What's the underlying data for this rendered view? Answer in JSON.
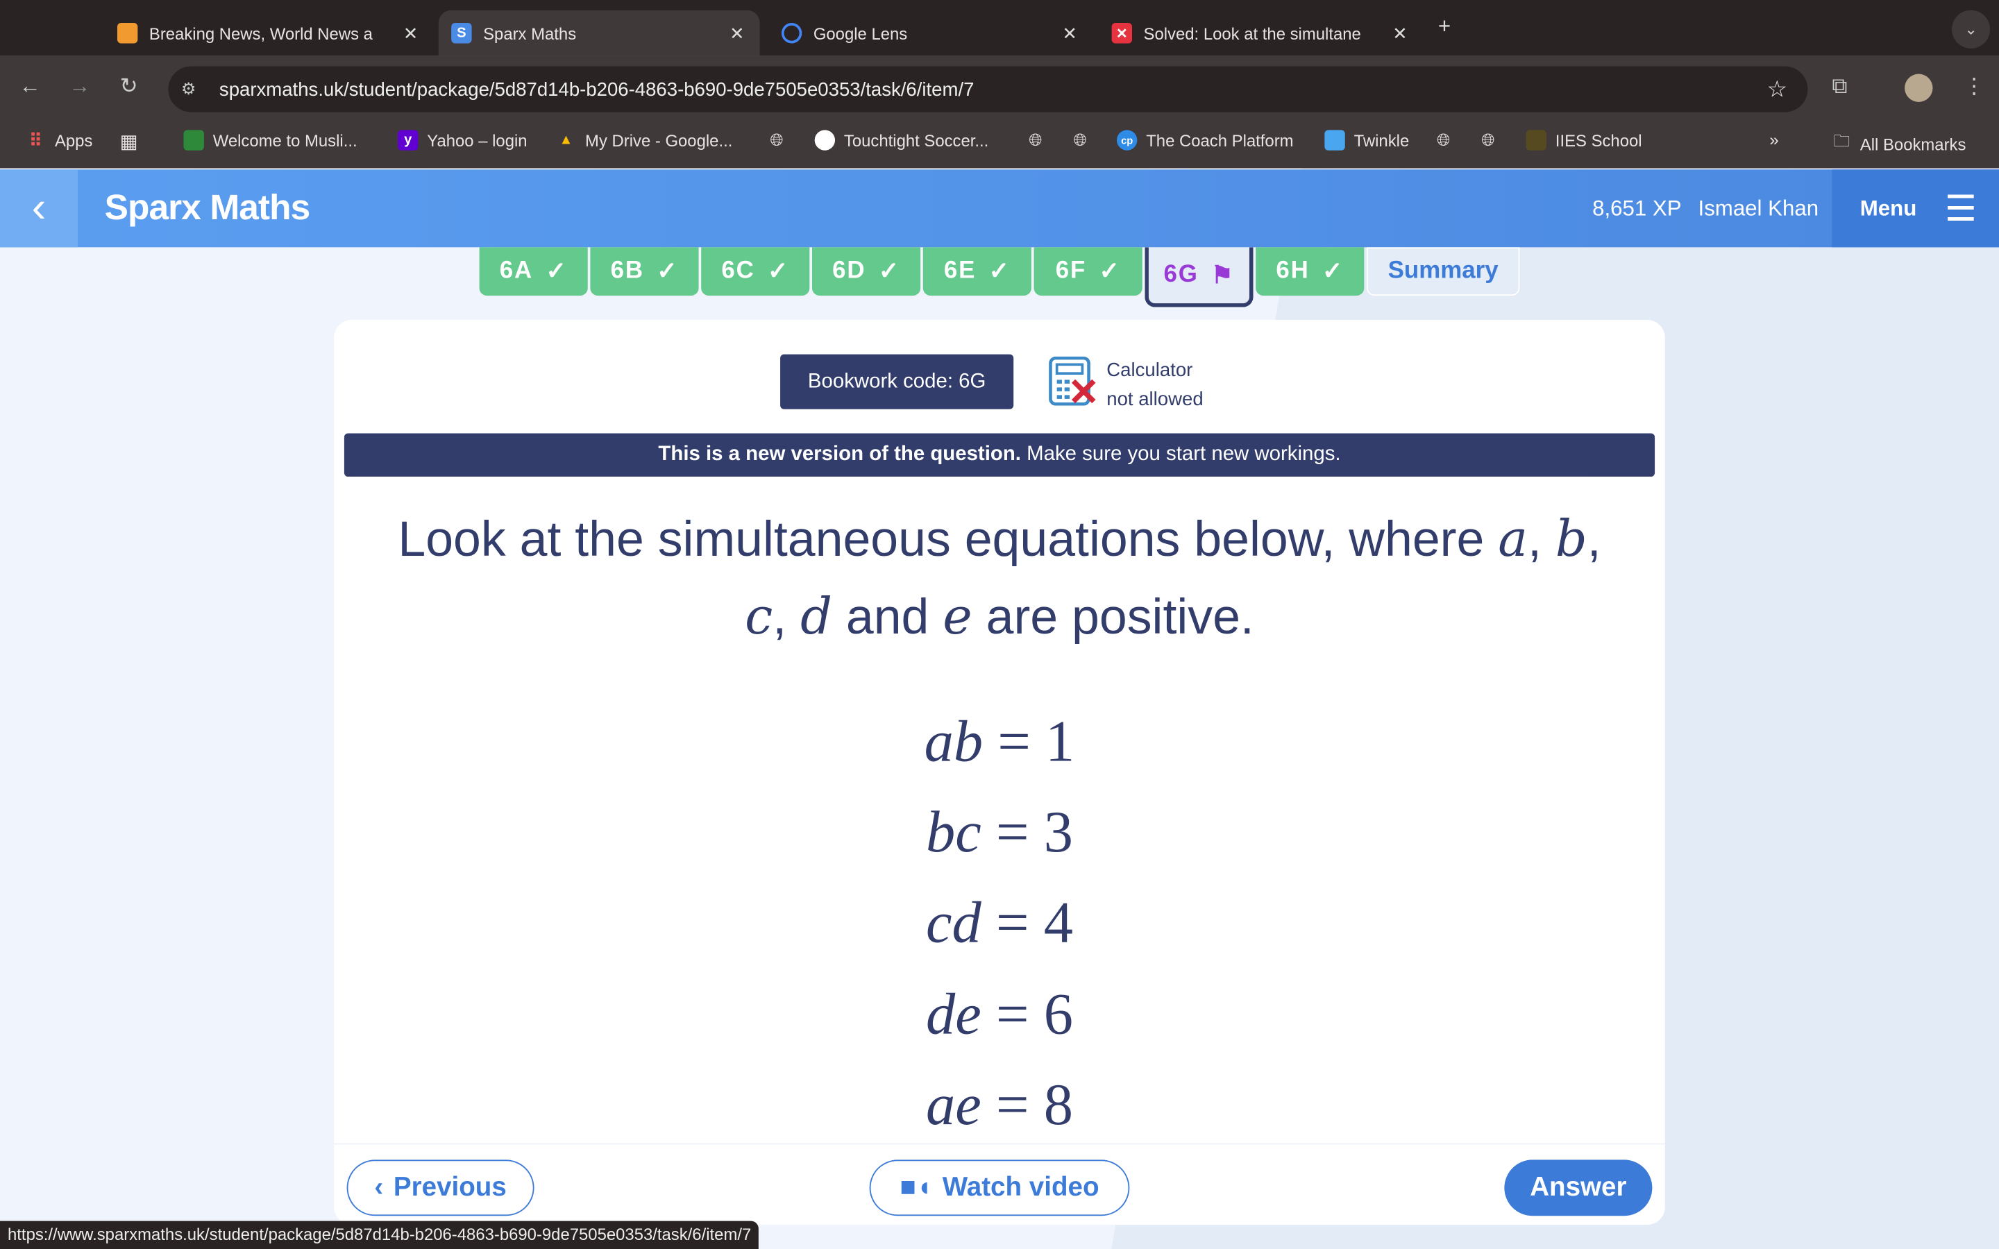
{
  "browser": {
    "tabs": [
      {
        "title": "Breaking News, World News a",
        "icon": "news-icon",
        "color": "#f19a30",
        "active": false
      },
      {
        "title": "Sparx Maths",
        "icon": "sparx-icon",
        "color": "#4a8be6",
        "active": true
      },
      {
        "title": "Google Lens",
        "icon": "google-lens-icon",
        "color": "#2a2323",
        "active": false
      },
      {
        "title": "Solved: Look at the simultane",
        "icon": "chegg-icon",
        "color": "#e5333f",
        "active": false
      }
    ],
    "url": "sparxmaths.uk/student/package/5d87d14b-b206-4863-b690-9de7505e0353/task/6/item/7",
    "bookmarks": [
      "Apps",
      "Welcome to Musli...",
      "Yahoo – login",
      "My Drive - Google...",
      "Touchtight Soccer...",
      "The Coach Platform",
      "Twinkle",
      "IIES School"
    ],
    "all_bookmarks": "All Bookmarks",
    "status_url": "https://www.sparxmaths.uk/student/package/5d87d14b-b206-4863-b690-9de7505e0353/task/6/item/7"
  },
  "header": {
    "brand": "Sparx Maths",
    "xp": "8,651 XP",
    "user": "Ismael Khan",
    "menu": "Menu"
  },
  "task_tabs": [
    {
      "label": "6A",
      "status": "done"
    },
    {
      "label": "6B",
      "status": "done"
    },
    {
      "label": "6C",
      "status": "done"
    },
    {
      "label": "6D",
      "status": "done"
    },
    {
      "label": "6E",
      "status": "done"
    },
    {
      "label": "6F",
      "status": "done"
    },
    {
      "label": "6G",
      "status": "current-flagged"
    },
    {
      "label": "6H",
      "status": "done"
    },
    {
      "label": "Summary",
      "status": "summary"
    }
  ],
  "question": {
    "bookwork_code": "Bookwork code: 6G",
    "calculator_line1": "Calculator",
    "calculator_line2": "not allowed",
    "notice_bold": "This is a new version of the question.",
    "notice_rest": " Make sure you start new workings.",
    "text_part1": "Look at the simultaneous equations below, where ",
    "text_vars": [
      "a",
      "b",
      "c",
      "d",
      "e"
    ],
    "text_part2": " are positive.",
    "equations": [
      {
        "lhs": "ab",
        "rhs": "1"
      },
      {
        "lhs": "bc",
        "rhs": "3"
      },
      {
        "lhs": "cd",
        "rhs": "4"
      },
      {
        "lhs": "de",
        "rhs": "6"
      },
      {
        "lhs": "ae",
        "rhs": "8"
      }
    ]
  },
  "footer": {
    "previous": "Previous",
    "watch": "Watch video",
    "answer": "Answer"
  },
  "colors": {
    "brand": "#4b88e0",
    "done": "#64c98d",
    "navy": "#323d6b",
    "flag": "#9a3ad6"
  }
}
